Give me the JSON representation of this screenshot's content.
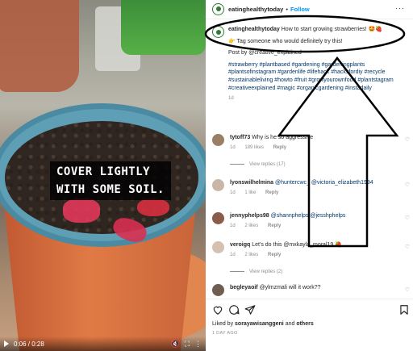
{
  "video": {
    "caption_line1": "COVER LIGHTLY",
    "caption_line2": "WITH SOME SOIL.",
    "time": "0:06 / 0:28"
  },
  "post": {
    "username": "eatinghealthytoday",
    "follow_label": "Follow",
    "caption": "How to start growing strawberries! 🤩🍓",
    "tag_line": "👉 Tag someone who would definitely try this!",
    "credit": "Post by @creative_explained",
    "hashtags": "#strawberry #plantbased #gardening #gardeningplants #plantsofinstagram #gardenlife #lifehack #hacksfordiy #recycle #sustainableliving #howto #fruit #growyourownfood #plantstagram #creativeexplained #magic #organicgardening #instadaily",
    "time": "1d"
  },
  "comments": [
    {
      "user": "tytoff73",
      "text": "Why is he so aggressive",
      "time": "1d",
      "likes": "189 likes",
      "reply": "Reply",
      "view_replies": "View replies (17)"
    },
    {
      "user": "lyonswilhelmina",
      "text": "@huntercwc_ @victoria_elizabeth1994",
      "time": "1d",
      "likes": "1 like",
      "reply": "Reply"
    },
    {
      "user": "jennyphelps98",
      "text": "@shannphelps @jesshphelps",
      "time": "1d",
      "likes": "2 likes",
      "reply": "Reply"
    },
    {
      "user": "veroigq",
      "text": "Let's do this @mxkayla_moral19 🍓",
      "time": "1d",
      "likes": "2 likes",
      "reply": "Reply",
      "view_replies": "View replies (2)"
    },
    {
      "user": "begleyaoif",
      "text": "@ylmzmali will it work??",
      "time": "",
      "likes": "",
      "reply": ""
    }
  ],
  "footer": {
    "liked_prefix": "Liked by",
    "liked_user": "sorayawisanggeni",
    "liked_and": "and",
    "liked_others": "others",
    "ago": "1 DAY AGO"
  },
  "colors": {
    "link": "#00376b",
    "follow": "#0095f6",
    "muted": "#8e8e8e",
    "brand_green": "#2e7d32"
  },
  "icons": [
    "heart-icon",
    "comment-icon",
    "share-icon",
    "bookmark-icon",
    "more-icon",
    "play-icon",
    "volume-icon",
    "fullscreen-icon"
  ]
}
